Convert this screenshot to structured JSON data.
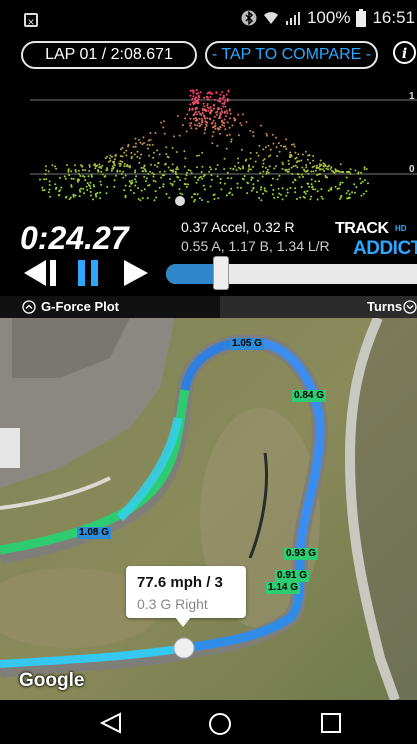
{
  "status_bar": {
    "close_glyph": "×",
    "battery_text": "100%",
    "time": "16:51"
  },
  "header": {
    "lap_label": "LAP 01 / 2:08.671",
    "compare_label": "- TAP TO COMPARE -",
    "info_icon": "i"
  },
  "gforce_plot": {
    "y_labels": [
      "1",
      "0"
    ]
  },
  "playback": {
    "elapsed": "0:24.27",
    "accel_line1": "0.37 Accel, 0.32 R",
    "accel_line2": "0.55 A, 1.17 B, 1.34 L/R",
    "progress": 0.22
  },
  "logo": {
    "line1": "TRACK",
    "line2": "ADDICT",
    "badge": "HD"
  },
  "tabs": {
    "left": "G-Force Plot",
    "right": "Turns"
  },
  "map": {
    "g_labels": [
      "1.05 G",
      "0.84 G",
      "1.08 G",
      "0.93 G",
      "0.91 G",
      "1.14 G"
    ],
    "bubble_speed": "77.6 mph / 3",
    "bubble_g": "0.3 G Right",
    "attribution": "Google"
  },
  "colors": {
    "accent_blue": "#2ea8ff",
    "slider_fill": "#2f86c8"
  }
}
